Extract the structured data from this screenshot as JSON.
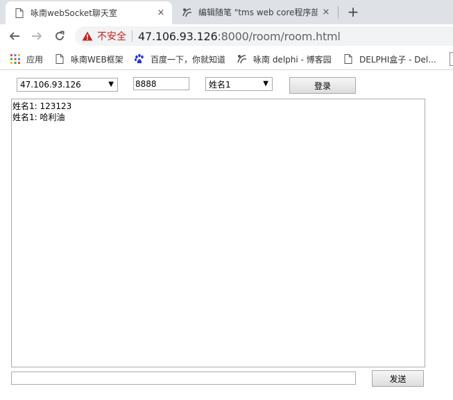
{
  "browser": {
    "tabs": [
      {
        "title": "咏南webSocket聊天室",
        "active": true,
        "icon": "page-icon",
        "close": "×"
      },
      {
        "title": "编辑随笔 \"tms web core程序部",
        "active": false,
        "icon": "cnblogs-icon",
        "close": "×"
      }
    ],
    "new_tab": "+",
    "address": {
      "security_label": "不安全",
      "host": "47.106.93.126",
      "path": ":8000/room/room.html"
    },
    "bookmarks": [
      {
        "label": "应用",
        "icon": "apps-grid-icon"
      },
      {
        "label": "咏南WEB框架",
        "icon": "page-icon"
      },
      {
        "label": "百度一下，你就知道",
        "icon": "baidu-paw-icon"
      },
      {
        "label": "咏南 delphi - 博客园",
        "icon": "cnblogs-icon"
      },
      {
        "label": "DELPHI盒子 - Del...",
        "icon": "page-icon"
      }
    ]
  },
  "page": {
    "server_select": "47.106.93.126",
    "port_value": "8888",
    "name_select": "姓名1",
    "login_label": "登录",
    "messages": [
      "姓名1: 123123",
      "姓名1: 哈利油"
    ],
    "message_input": "",
    "send_label": "发送"
  },
  "colors": {
    "tab_strip": "#dee1e6",
    "insecure_red": "#c5221f",
    "omnibox_bg": "#f1f3f4"
  }
}
